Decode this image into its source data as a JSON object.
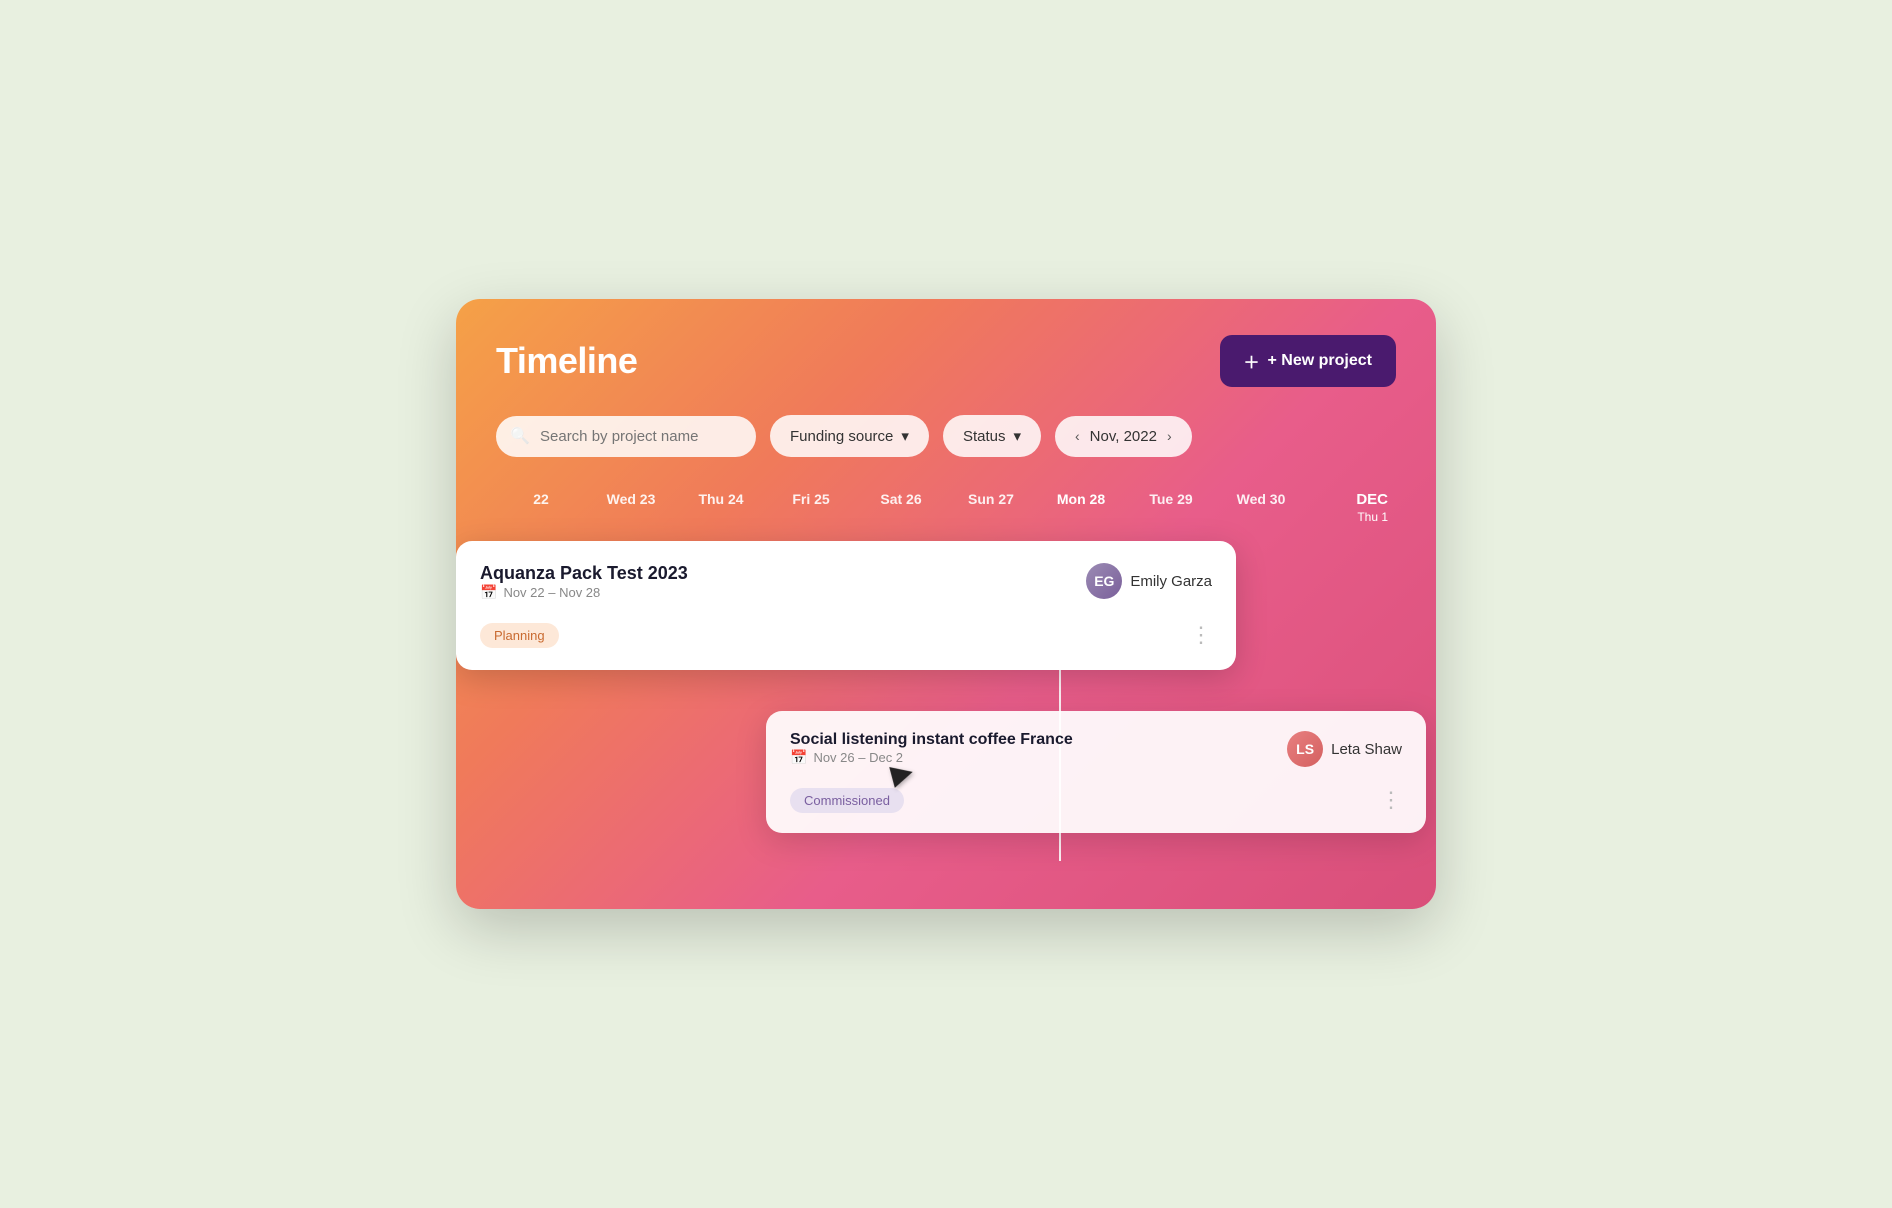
{
  "page": {
    "title": "Timeline",
    "new_project_btn": "+ New project"
  },
  "filters": {
    "search_placeholder": "Search by project name",
    "funding_source_label": "Funding source",
    "status_label": "Status",
    "month_label": "Nov, 2022",
    "chevron_down": "▾",
    "chevron_left": "‹",
    "chevron_right": "›"
  },
  "calendar": {
    "columns": [
      {
        "id": "col-22",
        "label": "22",
        "sub": ""
      },
      {
        "id": "col-23",
        "label": "Wed 23",
        "sub": ""
      },
      {
        "id": "col-24",
        "label": "Thu 24",
        "sub": ""
      },
      {
        "id": "col-25",
        "label": "Fri 25",
        "sub": ""
      },
      {
        "id": "col-26",
        "label": "Sat 26",
        "sub": ""
      },
      {
        "id": "col-27",
        "label": "Sun 27",
        "sub": ""
      },
      {
        "id": "col-28",
        "label": "Mon 28",
        "sub": "",
        "today": true
      },
      {
        "id": "col-29",
        "label": "Tue 29",
        "sub": ""
      },
      {
        "id": "col-30",
        "label": "Wed 30",
        "sub": ""
      },
      {
        "id": "col-dec",
        "label": "DEC",
        "sub": "Thu 1",
        "is_month": true
      }
    ]
  },
  "projects": [
    {
      "id": "aquanza",
      "title": "Aquanza Pack Test 2023",
      "date_range": "Nov 22 – Nov 28",
      "status": "Planning",
      "assignee_name": "Emily Garza",
      "assignee_initials": "EG"
    },
    {
      "id": "social",
      "title": "Social listening instant coffee France",
      "date_range": "Nov 26 – Dec 2",
      "status": "Commissioned",
      "assignee_name": "Leta Shaw",
      "assignee_initials": "LS"
    }
  ]
}
